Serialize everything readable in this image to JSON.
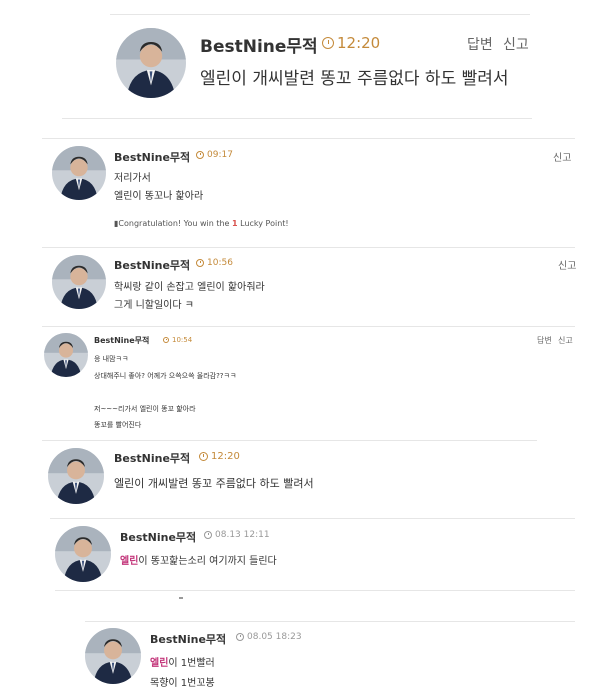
{
  "comments": [
    {
      "author": "BestNine무적",
      "time": "12:20",
      "actions": [
        "답변",
        "신고"
      ],
      "lines": [
        "엘린이 개씨발련 똥꼬 주름없다 하도 빨려서"
      ]
    },
    {
      "author": "BestNine무적",
      "time": "09:17",
      "actions": [
        "신고"
      ],
      "lines": [
        "저리가서",
        "엘린이 똥꼬나 핥아라"
      ],
      "notice": {
        "prefix": "Congratulation! You win the ",
        "count": "1",
        "suffix": " Lucky Point!"
      }
    },
    {
      "author": "BestNine무적",
      "time": "10:56",
      "actions": [
        "신고"
      ],
      "lines": [
        "학씨랑 같이 손잡고 엘린이 핥아줘라",
        "그게 니할일이다 ㅋ"
      ]
    },
    {
      "author": "BestNine무적",
      "time": "10:54",
      "actions": [
        "답변",
        "신고"
      ],
      "lines": [
        "응 내맘ㅋㅋ",
        "상대해주니 좋아? 어께가 으쓱으쓱 올라감??ㅋㅋ",
        "",
        "저~~~리가서 엘린이 똥꼬 핥아라",
        "똥꼬를 빨어진다"
      ]
    },
    {
      "author": "BestNine무적",
      "time": "12:20",
      "actions": [],
      "lines": [
        "엘린이 개씨발련 똥꼬 주름없다 하도 빨려서"
      ]
    },
    {
      "author": "BestNine무적",
      "time": "08.13 12:11",
      "actions": [],
      "highlight": "엘린",
      "lines": [
        "이 똥꼬핥는소리 여기까지 들린다"
      ]
    },
    {
      "author": "BestNine무적",
      "time": "08.05 18:23",
      "actions": [],
      "highlight": "엘린",
      "lines": [
        "이 1번빨러",
        "목향이 1번꼬봉"
      ]
    }
  ]
}
